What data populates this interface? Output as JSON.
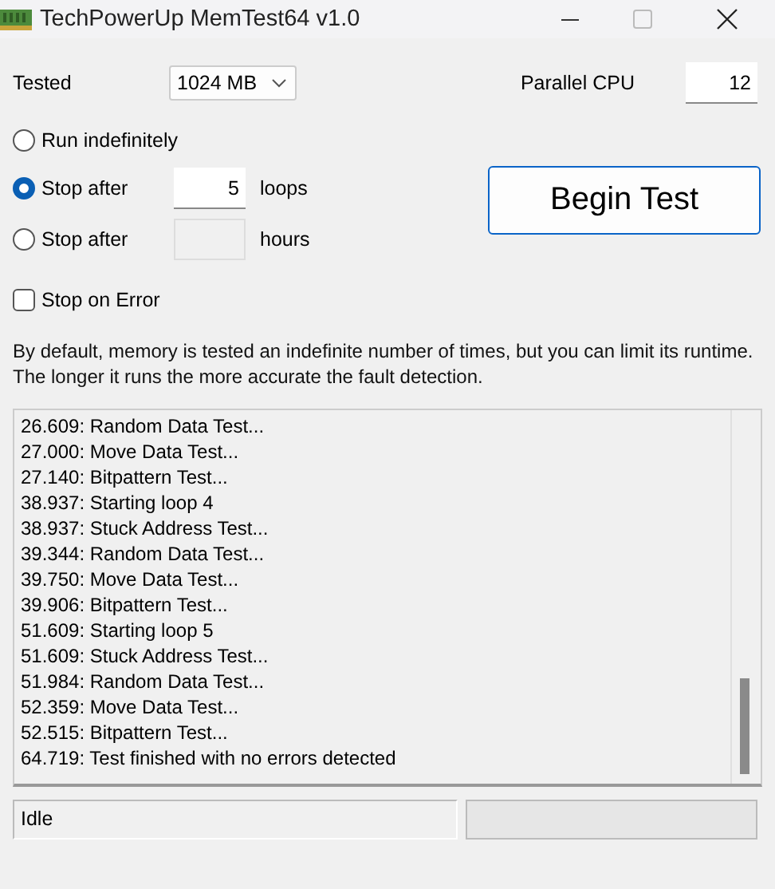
{
  "window": {
    "title": "TechPowerUp MemTest64 v1.0"
  },
  "tested": {
    "label": "Tested",
    "value": "1024 MB"
  },
  "parallel": {
    "label": "Parallel CPU",
    "value": "12"
  },
  "modes": [
    {
      "kind": "plain",
      "label": "Run indefinitely",
      "selected": false
    },
    {
      "kind": "field",
      "label": "Stop after",
      "value": "5",
      "unit": "loops",
      "disabled": false,
      "selected": true
    },
    {
      "kind": "field",
      "label": "Stop after",
      "unit": "hours",
      "disabled": true,
      "selected": false
    }
  ],
  "stop_on_error": {
    "label": "Stop on Error",
    "checked": false
  },
  "begin_button": "Begin Test",
  "description": "By default, memory is tested an indefinite number of times, but you can limit its runtime. The longer it runs the more accurate the fault detection.",
  "log": [
    "26.609: Random Data Test...",
    "27.000: Move Data Test...",
    "27.140: Bitpattern Test...",
    "38.937: Starting loop 4",
    "38.937: Stuck Address Test...",
    "39.344: Random Data Test...",
    "39.750: Move Data Test...",
    "39.906: Bitpattern Test...",
    "51.609: Starting loop 5",
    "51.609: Stuck Address Test...",
    "51.984: Random Data Test...",
    "52.359: Move Data Test...",
    "52.515: Bitpattern Test...",
    "64.719: Test finished with no errors detected"
  ],
  "status": {
    "text": "Idle",
    "level": 0
  }
}
